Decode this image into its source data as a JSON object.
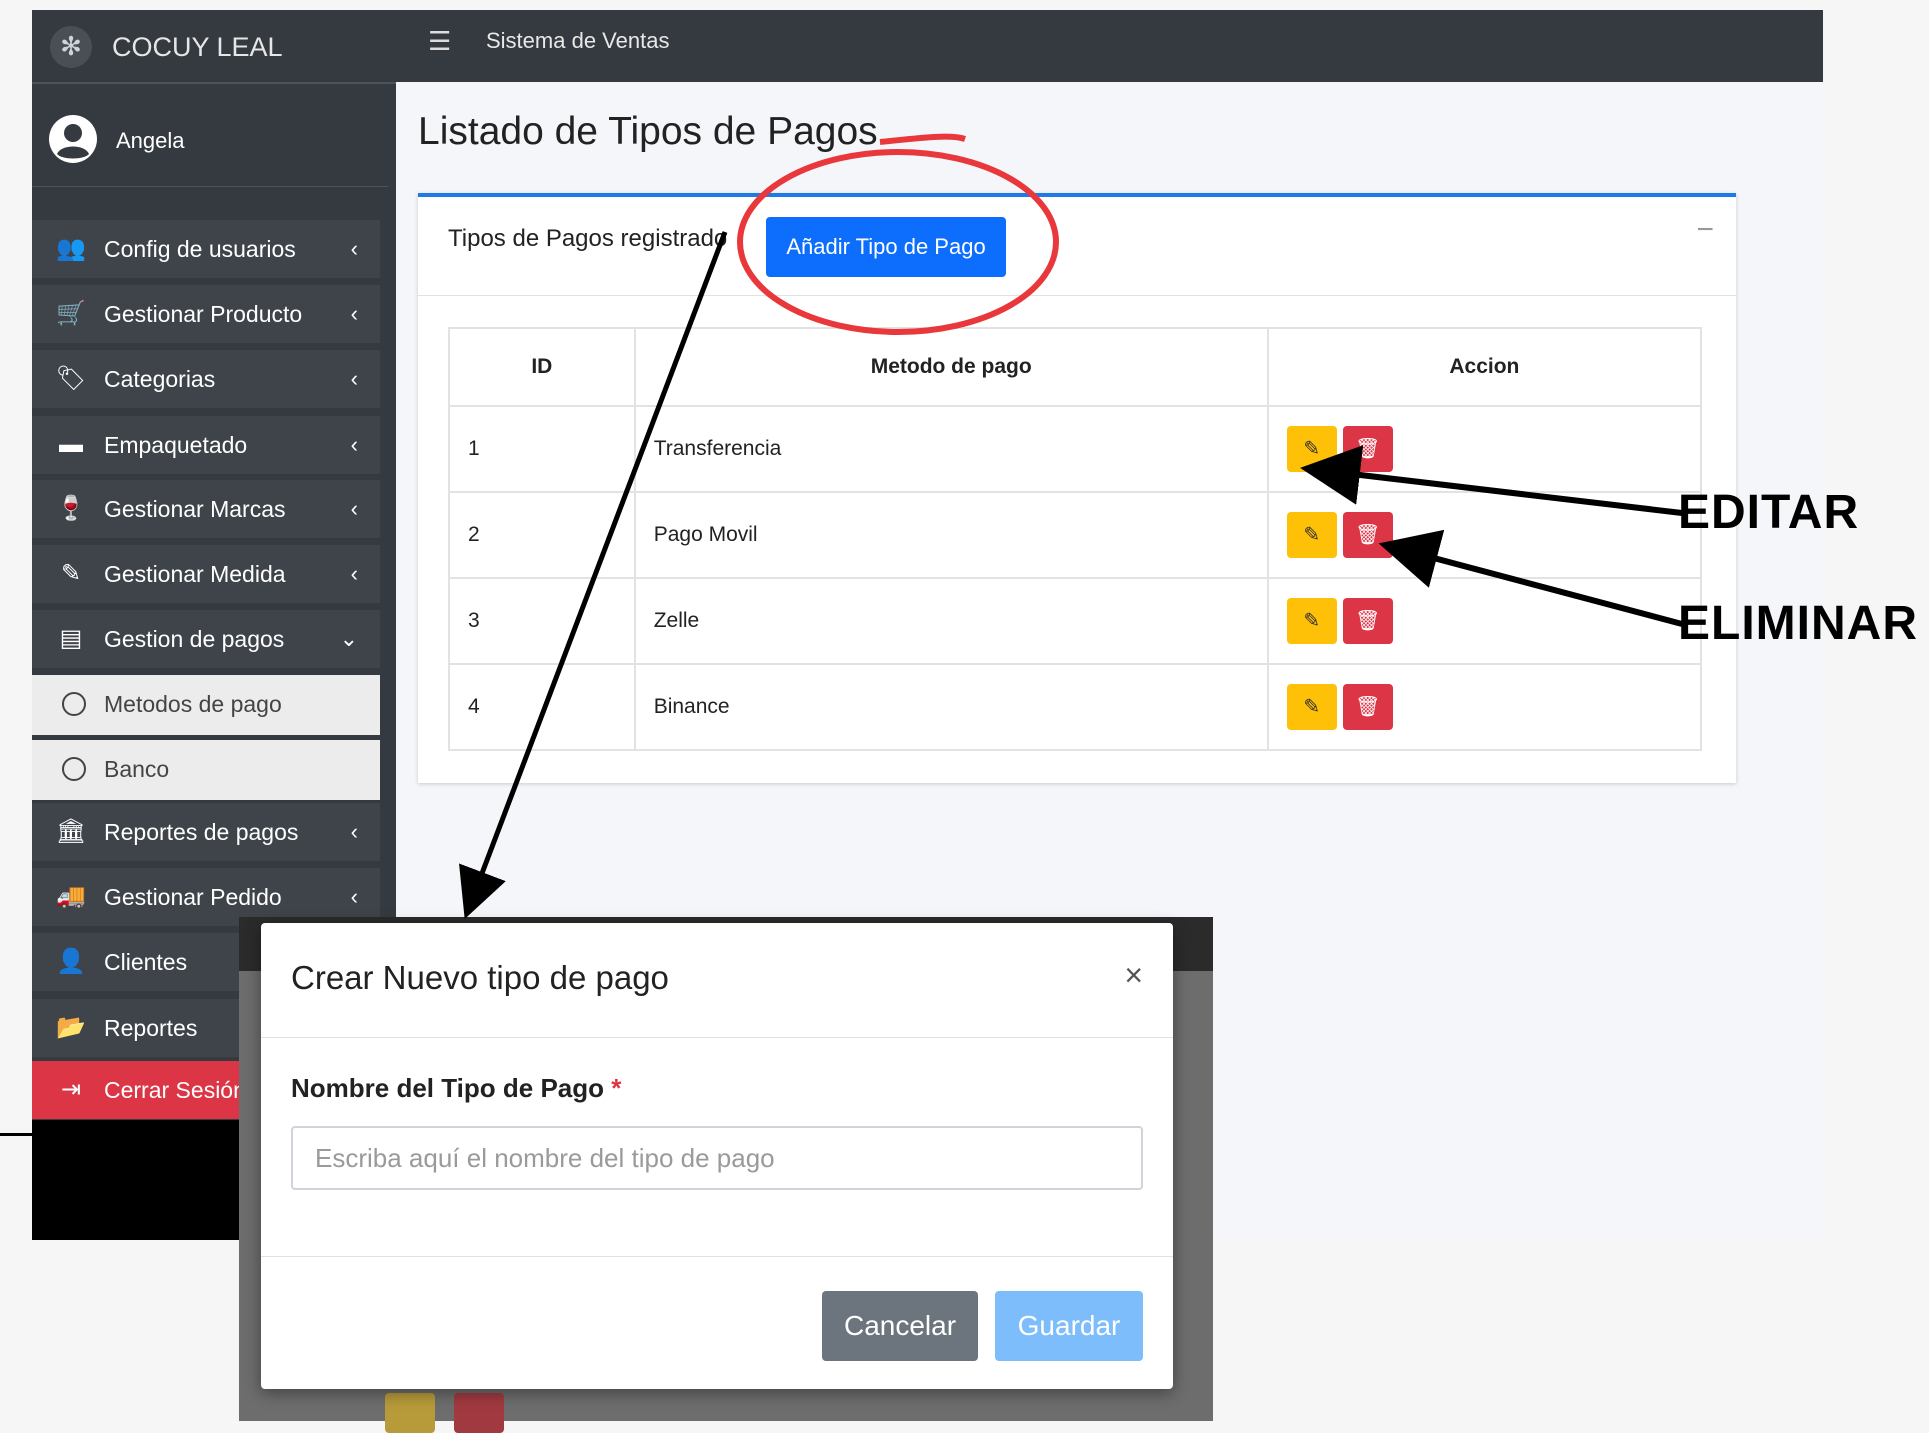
{
  "brand": {
    "name": "COCUY LEAL",
    "logo_icon": "leaf-logo-icon"
  },
  "topbar": {
    "menu_icon": "hamburger-icon",
    "title": "Sistema de Ventas"
  },
  "user": {
    "name": "Angela",
    "avatar_icon": "user-circle-icon"
  },
  "sidebar": {
    "items": [
      {
        "label": "Config de usuarios",
        "icon": "users-icon",
        "chevron": "‹"
      },
      {
        "label": "Gestionar Producto",
        "icon": "cart-icon",
        "chevron": "‹"
      },
      {
        "label": "Categorias",
        "icon": "tags-icon",
        "chevron": "‹"
      },
      {
        "label": "Empaquetado",
        "icon": "box-icon",
        "chevron": "‹"
      },
      {
        "label": "Gestionar Marcas",
        "icon": "wine-icon",
        "chevron": "‹"
      },
      {
        "label": "Gestionar Medida",
        "icon": "ruler-icon",
        "chevron": "‹"
      },
      {
        "label": "Gestion de pagos",
        "icon": "credit-card-icon",
        "chevron": "⌄"
      },
      {
        "label": "Metodos de pago",
        "icon": "circle-icon"
      },
      {
        "label": "Banco",
        "icon": "circle-icon"
      },
      {
        "label": "Reportes de pagos",
        "icon": "bank-icon",
        "chevron": "‹"
      },
      {
        "label": "Gestionar Pedido",
        "icon": "truck-icon",
        "chevron": "‹"
      },
      {
        "label": "Clientes",
        "icon": "user-tie-icon"
      },
      {
        "label": "Reportes",
        "icon": "folder-icon"
      },
      {
        "label": "Cerrar Sesión",
        "icon": "logout-icon"
      }
    ]
  },
  "page": {
    "title": "Listado de Tipos de Pagos"
  },
  "card": {
    "title": "Tipos de Pagos registrado",
    "add_button": "Añadir Tipo de Pago",
    "collapse": "−"
  },
  "table": {
    "headers": [
      "ID",
      "Metodo de pago",
      "Accion"
    ],
    "rows": [
      {
        "id": "1",
        "method": "Transferencia"
      },
      {
        "id": "2",
        "method": "Pago Movil"
      },
      {
        "id": "3",
        "method": "Zelle"
      },
      {
        "id": "4",
        "method": "Binance"
      }
    ]
  },
  "annotations": {
    "edit": "EDITAR",
    "delete": "ELIMINAR",
    "highlight_color": "#e8383b"
  },
  "modal": {
    "title": "Crear Nuevo tipo de pago",
    "close": "×",
    "field_label": "Nombre del Tipo de Pago",
    "required_mark": "*",
    "placeholder": "Escriba aquí el nombre del tipo de pago",
    "value": "",
    "cancel": "Cancelar",
    "save": "Guardar"
  },
  "colors": {
    "primary": "#0d6efd",
    "warning": "#ffc107",
    "danger": "#dc3545",
    "sidebar": "#343a40",
    "secondary": "#6c757d"
  }
}
